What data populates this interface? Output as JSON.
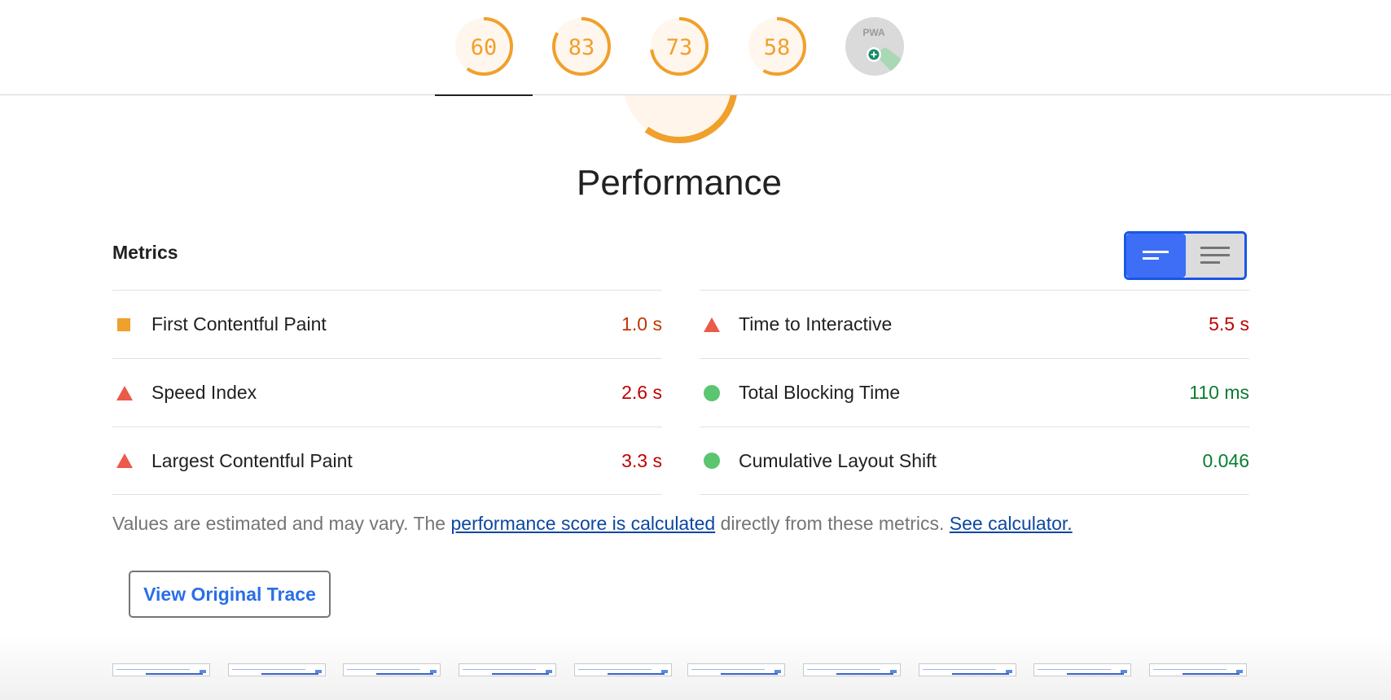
{
  "header": {
    "gauges": [
      {
        "name": "performance",
        "score": "60",
        "fraction": 0.6
      },
      {
        "name": "accessibility",
        "score": "83",
        "fraction": 0.83
      },
      {
        "name": "best-practices",
        "score": "73",
        "fraction": 0.73
      },
      {
        "name": "seo",
        "score": "58",
        "fraction": 0.58
      },
      {
        "name": "pwa",
        "label": "PWA"
      }
    ]
  },
  "category": {
    "title": "Performance"
  },
  "metrics": {
    "heading": "Metrics",
    "left": [
      {
        "title": "First Contentful Paint",
        "value": "1.0 s",
        "rating": "average"
      },
      {
        "title": "Speed Index",
        "value": "2.6 s",
        "rating": "fail"
      },
      {
        "title": "Largest Contentful Paint",
        "value": "3.3 s",
        "rating": "fail"
      }
    ],
    "right": [
      {
        "title": "Time to Interactive",
        "value": "5.5 s",
        "rating": "fail"
      },
      {
        "title": "Total Blocking Time",
        "value": "110 ms",
        "rating": "pass"
      },
      {
        "title": "Cumulative Layout Shift",
        "value": "0.046",
        "rating": "pass"
      }
    ],
    "note": {
      "prefix": "Values are estimated and may vary. The ",
      "link1": "performance score is calculated",
      "middle": " directly from these metrics. ",
      "link2": "See calculator."
    }
  },
  "trace_button": {
    "label": "View Original Trace"
  },
  "colors": {
    "average": "#f0a02c",
    "fail": "#eb5a4a",
    "pass": "#5bc56f",
    "toggle_active": "#3d6ef5"
  }
}
